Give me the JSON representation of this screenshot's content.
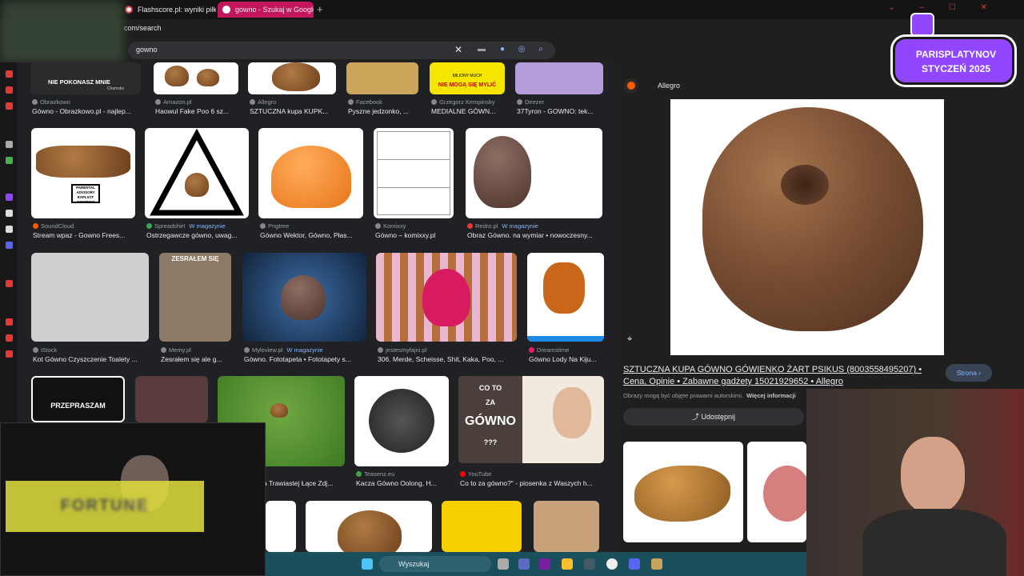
{
  "browser": {
    "tabs": [
      {
        "label": "Flashscore.pl: wyniki piłk"
      },
      {
        "label": "gowno - Szukaj w Google"
      }
    ],
    "url_visible": "com/search"
  },
  "search": {
    "query": "gowno"
  },
  "row1": {
    "meme_text": "NIE POKONASZ MNIE",
    "meme_small": "Chamsko",
    "banner_top": "MILIONY MUCH",
    "banner_bottom": "NIE MOGĄ SIĘ MYLIĆ",
    "items": [
      {
        "source": "Obrazkowo",
        "title": "Gówno - Obrazkowo.pl - najlep..."
      },
      {
        "source": "Amazon.pl",
        "title": "Haowul Fake Poo 6 sz..."
      },
      {
        "source": "Allegro",
        "title": "SZTUCZNA kupa KUPK..."
      },
      {
        "source": "Facebook",
        "title": "Pyszne jedzonko, ..."
      },
      {
        "source": "Grzegorz Kempinsky",
        "title": "MEDIALNE GÓWN..."
      },
      {
        "source": "Deezer",
        "title": "37Tyron - GOWNO: tek..."
      }
    ]
  },
  "row2": {
    "advisory": [
      "PARENTAL",
      "ADVISORY",
      "EXPLICIT CONTENT"
    ],
    "items": [
      {
        "source": "SoundCloud",
        "title": "Stream wpaz - Gowno Frees..."
      },
      {
        "source": "Spreadshirt",
        "badge": "W magazynie",
        "title": "Ostrzegawcze gówno, uwag..."
      },
      {
        "source": "Pngtree",
        "title": "Gówno Wektor, Gówno, Płas..."
      },
      {
        "source": "Komixxy",
        "title": "Gówno – komixxy.pl"
      },
      {
        "source": "Redro.pl",
        "badge": "W magazynie",
        "title": "Obraz Gówno. na wymiar • nowoczesny..."
      }
    ]
  },
  "row3": {
    "dog_caption": "ZESRAŁEM SIĘ",
    "items": [
      {
        "source": "iStock",
        "title": "Kot Gówno Czyszczenie Toalety ..."
      },
      {
        "source": "Memy.pl",
        "title": "Zesrałem się ale g..."
      },
      {
        "source": "Myloview.pl",
        "badge": "W magazynie",
        "title": "Gówno. Fototapeta • Fototapety s..."
      },
      {
        "source": "jestesmyfajni.pl",
        "title": "306. Merde, Scheisse, Shit, Kaka, Poo, ..."
      },
      {
        "source": "Dreamstime",
        "title": "Gówno Lody Na Kiju..."
      }
    ]
  },
  "row4": {
    "sorry_text": "PRZEPRASZAM",
    "yt_l1": "CO TO",
    "yt_l2": "ZA",
    "yt_l3": "GÓWNO",
    "yt_l4": "???",
    "items": [
      {
        "source": "",
        "title": "a Trawiastej Łące Zdj..."
      },
      {
        "source": "Teasenz.eu",
        "title": "Kacza Gówno Oolong, H..."
      },
      {
        "source": "YouTube",
        "title": "Co to za gówno?\" - piosenka z Waszych h..."
      }
    ]
  },
  "panel": {
    "source": "Allegro",
    "title": "SZTUCZNA KUPA GÓWNO GÓWIENKO ŻART PSIKUS (8003558495207) • Cena, Opinie • Zabawne gadżety 15021929652 • Allegro",
    "visit_label": "Strona",
    "note": "Obrazy mogą być objęte prawami autorskimi.",
    "note_link": "Więcej informacji",
    "share_label": "Udostępnij"
  },
  "overlay": {
    "line1": "PARISPLATYNOV",
    "line2": "STYCZEŃ 2025",
    "fortune": "FORTUNE"
  },
  "taskbar": {
    "search_label": "Wyszukaj"
  },
  "colors": {
    "accent_link": "#8ab4f8",
    "tab_active": "#c2185b",
    "twitch": "#9146ff",
    "taskbar": "#1a4f5c"
  }
}
